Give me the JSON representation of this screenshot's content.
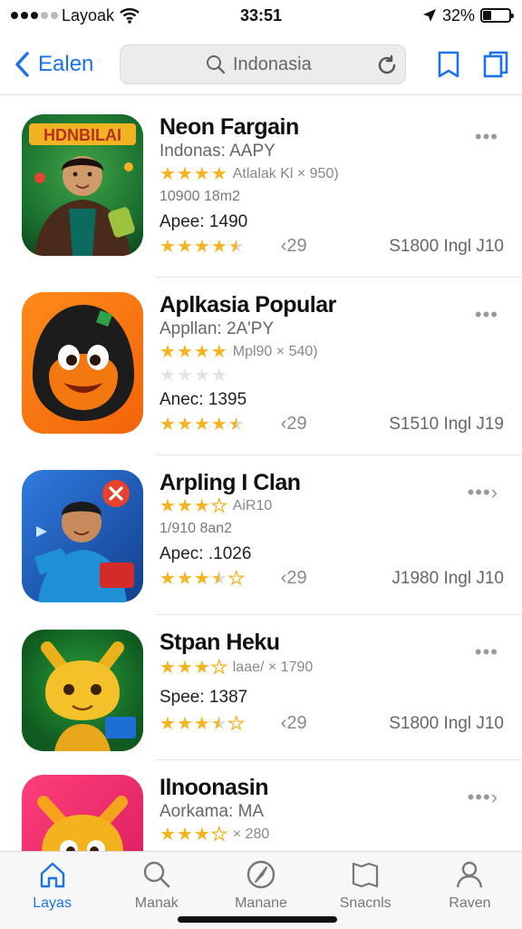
{
  "status_bar": {
    "carrier": "Layoak",
    "time": "33:51",
    "battery": "32%",
    "battery_level": 0.32
  },
  "nav": {
    "back_label": "Ealen",
    "search_query": "Indonasia"
  },
  "apps": [
    {
      "title": "Neon Fargain",
      "subtitle": "Indonas: AAPY",
      "rating_line": "Atlalak  Kl × 950)",
      "meta": "10900  18m2",
      "price": "Apee: 1490",
      "review_count": "‹29",
      "size": "S1800 Ingl J10",
      "rating": 4.5,
      "more": "•••"
    },
    {
      "title": "Aplkasia Popular",
      "subtitle": "Appllan: 2A'PY",
      "rating_line": "Mpl90 × 540)",
      "meta": "",
      "price": "Anec: 1395",
      "review_count": "‹29",
      "size": "S1510 Ingl J19",
      "rating": 4.5,
      "more": "•••"
    },
    {
      "title": "Arpling I Clan",
      "subtitle": "",
      "rating_line": "AiR10",
      "meta": "1/910  8an2",
      "price": "Apec: .1026",
      "review_count": "‹29",
      "size": "J1980 Ingl J10",
      "rating": 3.5,
      "more": "•••›"
    },
    {
      "title": "Stpan Heku",
      "subtitle": "",
      "rating_line": "laae/ × 1790",
      "meta": "",
      "price": "Spee: 1387",
      "review_count": "‹29",
      "size": "S1800 Ingl J10",
      "rating": 3.5,
      "more": "•••"
    },
    {
      "title": "Ilnoonasin",
      "subtitle": "Aorkama: MA",
      "rating_line": "× 280",
      "meta": "",
      "price": "",
      "review_count": "",
      "size": "",
      "rating": 3.5,
      "more": "•••›"
    }
  ],
  "tabs": [
    {
      "label": "Layas",
      "icon": "home-icon",
      "active": true
    },
    {
      "label": "Manak",
      "icon": "search-icon",
      "active": false
    },
    {
      "label": "Manane",
      "icon": "compass-icon",
      "active": false
    },
    {
      "label": "Snacnls",
      "icon": "bookmark-icon",
      "active": false
    },
    {
      "label": "Raven",
      "icon": "person-icon",
      "active": false
    }
  ],
  "colors": {
    "accent": "#1a73e8",
    "star": "#f5b320"
  }
}
